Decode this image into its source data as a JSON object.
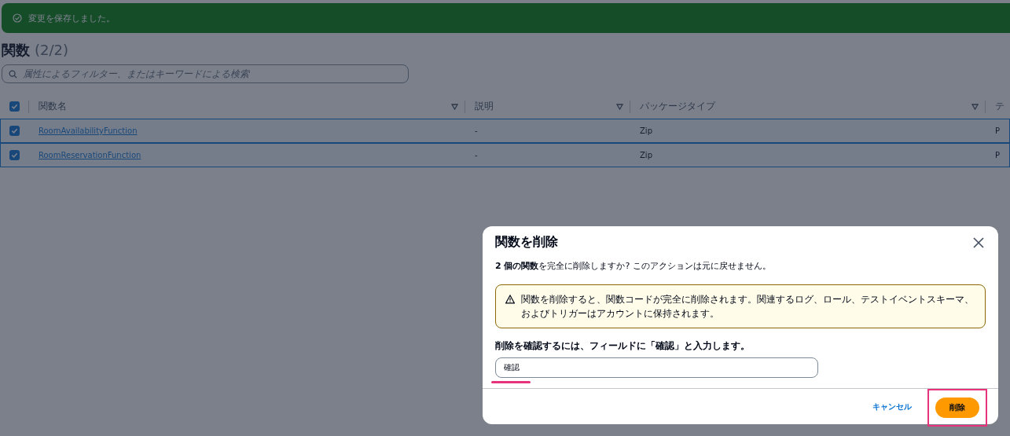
{
  "notification": {
    "kind": "success",
    "message": "変更を保存しました。"
  },
  "heading": {
    "title": "関数",
    "count": "(2/2)"
  },
  "search": {
    "placeholder": "属性によるフィルター、またはキーワードによる検索"
  },
  "table": {
    "select_all": {
      "checked": true
    },
    "columns": [
      {
        "label": "関数名",
        "sortable": true
      },
      {
        "label": "説明",
        "sortable": true
      },
      {
        "label": "パッケージタイプ",
        "sortable": true
      },
      {
        "label": "テ",
        "sortable": false
      }
    ],
    "rows": [
      {
        "selected": true,
        "cells": [
          "RoomAvailabilityFunction",
          "-",
          "Zip",
          "P"
        ]
      },
      {
        "selected": true,
        "cells": [
          "RoomReservationFunction",
          "-",
          "Zip",
          "P"
        ]
      }
    ]
  },
  "dialog": {
    "title": "関数を削除",
    "message": "**2 個の関数**を完全に削除しますか? このアクションは元に戻せません。",
    "warning": "関数を削除すると、関数コードが完全に削除されます。関連するログ、ロール、テストイベントスキーマ、およびトリガーはアカウントに保持されます。",
    "confirm_label": "削除を確認するには、フィールドに「確認」と入力します。",
    "confirm_value": "確認",
    "buttons": [
      {
        "kind": "link",
        "label": "キャンセル"
      },
      {
        "kind": "primary",
        "label": "削除"
      }
    ]
  }
}
